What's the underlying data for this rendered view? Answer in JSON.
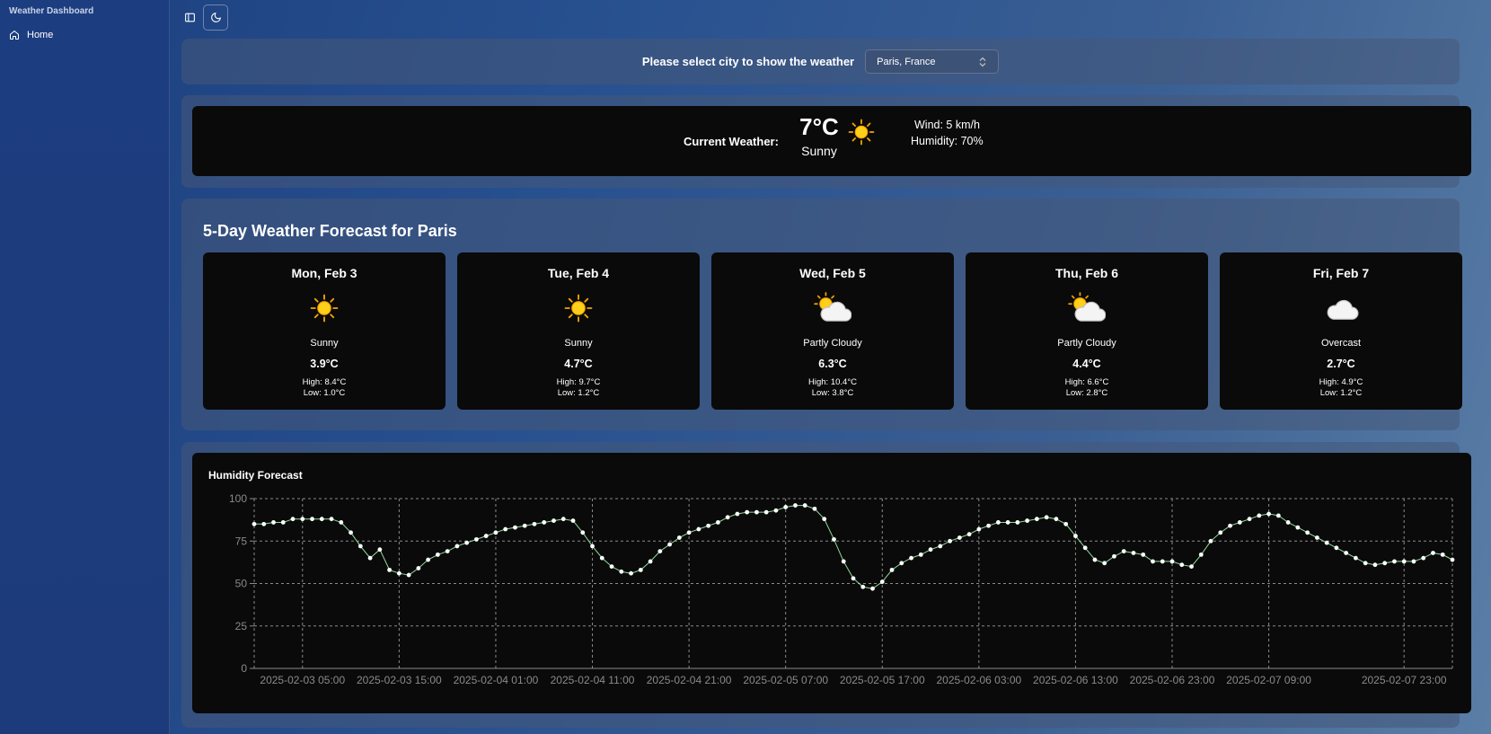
{
  "sidebar": {
    "title": "Weather Dashboard",
    "items": [
      {
        "label": "Home",
        "icon": "home-icon"
      }
    ]
  },
  "header": {
    "toggle_icon": "sidebar-toggle-icon",
    "theme_icon": "moon-icon"
  },
  "city_selector": {
    "label": "Please select city to show the weather",
    "selected": "Paris, France",
    "icon": "chevron-up-down-icon"
  },
  "current": {
    "label": "Current Weather:",
    "temp": "7°C",
    "condition": "Sunny",
    "icon": "sun-icon",
    "wind": "Wind: 5 km/h",
    "humidity": "Humidity: 70%"
  },
  "forecast": {
    "title": "5-Day Weather Forecast for Paris",
    "days": [
      {
        "date": "Mon, Feb 3",
        "icon": "sun-icon",
        "condition": "Sunny",
        "temp": "3.9°C",
        "high": "High: 8.4°C",
        "low": "Low: 1.0°C"
      },
      {
        "date": "Tue, Feb 4",
        "icon": "sun-icon",
        "condition": "Sunny",
        "temp": "4.7°C",
        "high": "High: 9.7°C",
        "low": "Low: 1.2°C"
      },
      {
        "date": "Wed, Feb 5",
        "icon": "partly-cloudy-icon",
        "condition": "Partly Cloudy",
        "temp": "6.3°C",
        "high": "High: 10.4°C",
        "low": "Low: 3.8°C"
      },
      {
        "date": "Thu, Feb 6",
        "icon": "partly-cloudy-icon",
        "condition": "Partly Cloudy",
        "temp": "4.4°C",
        "high": "High: 6.6°C",
        "low": "Low: 2.8°C"
      },
      {
        "date": "Fri, Feb 7",
        "icon": "cloud-icon",
        "condition": "Overcast",
        "temp": "2.7°C",
        "high": "High: 4.9°C",
        "low": "Low: 1.2°C"
      }
    ]
  },
  "colors": {
    "line": "#8fdc9a",
    "grid": "#8a8a8a",
    "axis_text": "#8a8a8a"
  },
  "chart_data": {
    "type": "line",
    "title": "Humidity Forecast",
    "xlabel": "",
    "ylabel": "",
    "ylim": [
      0,
      100
    ],
    "yticks": [
      0,
      25,
      50,
      75,
      100
    ],
    "grid": true,
    "x_tick_labels": [
      "2025-02-03 05:00",
      "2025-02-03 15:00",
      "2025-02-04 01:00",
      "2025-02-04 11:00",
      "2025-02-04 21:00",
      "2025-02-05 07:00",
      "2025-02-05 17:00",
      "2025-02-06 03:00",
      "2025-02-06 13:00",
      "2025-02-06 23:00",
      "2025-02-07 09:00",
      "2025-02-07 23:00"
    ],
    "x_start": "2025-02-03 00:00",
    "x_step_hours": 1,
    "series": [
      {
        "values": [
          85,
          85,
          86,
          86,
          88,
          88,
          88,
          88,
          88,
          86,
          80,
          72,
          65,
          70,
          58,
          56,
          55,
          59,
          64,
          67,
          69,
          72,
          74,
          76,
          78,
          80,
          82,
          83,
          84,
          85,
          86,
          87,
          88,
          87,
          80,
          72,
          65,
          60,
          57,
          56,
          58,
          63,
          69,
          73,
          77,
          80,
          82,
          84,
          86,
          89,
          91,
          92,
          92,
          92,
          93,
          95,
          96,
          96,
          94,
          88,
          76,
          63,
          53,
          48,
          47,
          51,
          58,
          62,
          65,
          67,
          70,
          72,
          75,
          77,
          79,
          82,
          84,
          86,
          86,
          86,
          87,
          88,
          89,
          88,
          85,
          78,
          71,
          64,
          62,
          66,
          69,
          68,
          67,
          63,
          63,
          63,
          61,
          60,
          67,
          75,
          80,
          84,
          86,
          88,
          90,
          91,
          90,
          86,
          83,
          80,
          77,
          74,
          71,
          68,
          65,
          62,
          61,
          62,
          63,
          63,
          63,
          65,
          68,
          67,
          64
        ]
      }
    ]
  }
}
